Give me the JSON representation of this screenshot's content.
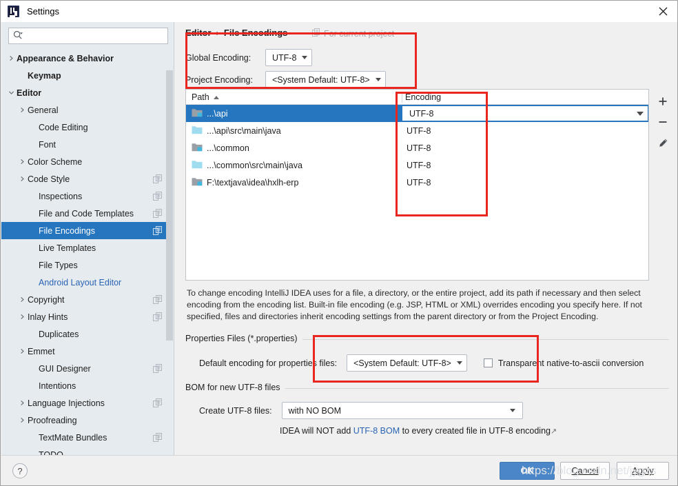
{
  "window": {
    "title": "Settings",
    "close_label": "✕",
    "logo_name": "intellij-idea-logo"
  },
  "search": {
    "value": "",
    "placeholder": ""
  },
  "sidebar": {
    "items": [
      {
        "label": "Appearance & Behavior",
        "indent": 0,
        "arrow": "collapsed",
        "bold": true,
        "blue": false,
        "selected": false,
        "scope_icon": false
      },
      {
        "label": "Keymap",
        "indent": 1,
        "arrow": "none",
        "bold": true,
        "blue": false,
        "selected": false,
        "scope_icon": false
      },
      {
        "label": "Editor",
        "indent": 0,
        "arrow": "expanded",
        "bold": true,
        "blue": false,
        "selected": false,
        "scope_icon": false
      },
      {
        "label": "General",
        "indent": 1,
        "arrow": "collapsed",
        "bold": false,
        "blue": false,
        "selected": false,
        "scope_icon": false
      },
      {
        "label": "Code Editing",
        "indent": 2,
        "arrow": "none",
        "bold": false,
        "blue": false,
        "selected": false,
        "scope_icon": false
      },
      {
        "label": "Font",
        "indent": 2,
        "arrow": "none",
        "bold": false,
        "blue": false,
        "selected": false,
        "scope_icon": false
      },
      {
        "label": "Color Scheme",
        "indent": 1,
        "arrow": "collapsed",
        "bold": false,
        "blue": false,
        "selected": false,
        "scope_icon": false
      },
      {
        "label": "Code Style",
        "indent": 1,
        "arrow": "collapsed",
        "bold": false,
        "blue": false,
        "selected": false,
        "scope_icon": true
      },
      {
        "label": "Inspections",
        "indent": 2,
        "arrow": "none",
        "bold": false,
        "blue": false,
        "selected": false,
        "scope_icon": true
      },
      {
        "label": "File and Code Templates",
        "indent": 2,
        "arrow": "none",
        "bold": false,
        "blue": false,
        "selected": false,
        "scope_icon": true
      },
      {
        "label": "File Encodings",
        "indent": 2,
        "arrow": "none",
        "bold": false,
        "blue": false,
        "selected": true,
        "scope_icon": true
      },
      {
        "label": "Live Templates",
        "indent": 2,
        "arrow": "none",
        "bold": false,
        "blue": false,
        "selected": false,
        "scope_icon": false
      },
      {
        "label": "File Types",
        "indent": 2,
        "arrow": "none",
        "bold": false,
        "blue": false,
        "selected": false,
        "scope_icon": false
      },
      {
        "label": "Android Layout Editor",
        "indent": 2,
        "arrow": "none",
        "bold": false,
        "blue": true,
        "selected": false,
        "scope_icon": false
      },
      {
        "label": "Copyright",
        "indent": 1,
        "arrow": "collapsed",
        "bold": false,
        "blue": false,
        "selected": false,
        "scope_icon": true
      },
      {
        "label": "Inlay Hints",
        "indent": 1,
        "arrow": "collapsed",
        "bold": false,
        "blue": false,
        "selected": false,
        "scope_icon": true
      },
      {
        "label": "Duplicates",
        "indent": 2,
        "arrow": "none",
        "bold": false,
        "blue": false,
        "selected": false,
        "scope_icon": false
      },
      {
        "label": "Emmet",
        "indent": 1,
        "arrow": "collapsed",
        "bold": false,
        "blue": false,
        "selected": false,
        "scope_icon": false
      },
      {
        "label": "GUI Designer",
        "indent": 2,
        "arrow": "none",
        "bold": false,
        "blue": false,
        "selected": false,
        "scope_icon": true
      },
      {
        "label": "Intentions",
        "indent": 2,
        "arrow": "none",
        "bold": false,
        "blue": false,
        "selected": false,
        "scope_icon": false
      },
      {
        "label": "Language Injections",
        "indent": 1,
        "arrow": "collapsed",
        "bold": false,
        "blue": false,
        "selected": false,
        "scope_icon": true
      },
      {
        "label": "Proofreading",
        "indent": 1,
        "arrow": "collapsed",
        "bold": false,
        "blue": false,
        "selected": false,
        "scope_icon": false
      },
      {
        "label": "TextMate Bundles",
        "indent": 2,
        "arrow": "none",
        "bold": false,
        "blue": false,
        "selected": false,
        "scope_icon": true
      },
      {
        "label": "TODO",
        "indent": 2,
        "arrow": "none",
        "bold": false,
        "blue": false,
        "selected": false,
        "scope_icon": false
      }
    ]
  },
  "main": {
    "breadcrumb": {
      "root": "Editor",
      "sep": "›",
      "leaf": "File Encodings"
    },
    "for_current_project": "For current project",
    "global_encoding": {
      "label": "Global Encoding:",
      "value": "UTF-8"
    },
    "project_encoding": {
      "label": "Project Encoding:",
      "value": "<System Default: UTF-8>"
    },
    "table": {
      "columns": [
        "Path",
        "Encoding"
      ],
      "sort_column": "Path",
      "sort_direction": "asc",
      "rows": [
        {
          "path": "...\\api",
          "encoding": "UTF-8",
          "icon": "module-folder-icon",
          "selected": true,
          "editing": true
        },
        {
          "path": "...\\api\\src\\main\\java",
          "encoding": "UTF-8",
          "icon": "folder-icon",
          "selected": false,
          "editing": false
        },
        {
          "path": "...\\common",
          "encoding": "UTF-8",
          "icon": "module-folder-icon",
          "selected": false,
          "editing": false
        },
        {
          "path": "...\\common\\src\\main\\java",
          "encoding": "UTF-8",
          "icon": "folder-icon",
          "selected": false,
          "editing": false
        },
        {
          "path": "F:\\textjava\\idea\\hxlh-erp",
          "encoding": "UTF-8",
          "icon": "module-folder-icon",
          "selected": false,
          "editing": false
        }
      ],
      "editing_value": "UTF-8"
    },
    "toolbar": {
      "add": "+",
      "remove": "−",
      "edit": "✎"
    },
    "description": "To change encoding IntelliJ IDEA uses for a file, a directory, or the entire project, add its path if necessary and then select encoding from the encoding list. Built-in file encoding (e.g. JSP, HTML or XML) overrides encoding you specify here. If not specified, files and directories inherit encoding settings from the parent directory or from the Project Encoding.",
    "properties_group": {
      "title": "Properties Files (*.properties)",
      "default_encoding_label": "Default encoding for properties files:",
      "default_encoding_value": "<System Default: UTF-8>",
      "transparent_label": "Transparent native-to-ascii conversion",
      "transparent_checked": false
    },
    "bom_group": {
      "title": "BOM for new UTF-8 files",
      "create_label": "Create UTF-8 files:",
      "create_value": "with NO BOM",
      "hint_prefix": "IDEA will NOT add ",
      "hint_link": "UTF-8 BOM",
      "hint_suffix": " to every created file in UTF-8 encoding",
      "hint_arrow": "↗"
    }
  },
  "footer": {
    "help": "?",
    "ok": "OK",
    "cancel": "Cancel",
    "apply": "Apply"
  },
  "watermark": "https://blog.csdn.net/jygzs",
  "colors": {
    "selection_blue": "#2675bf",
    "link_blue": "#2a63b5",
    "annotation_red": "#e8251f",
    "primary_button": "#4a86c8"
  }
}
